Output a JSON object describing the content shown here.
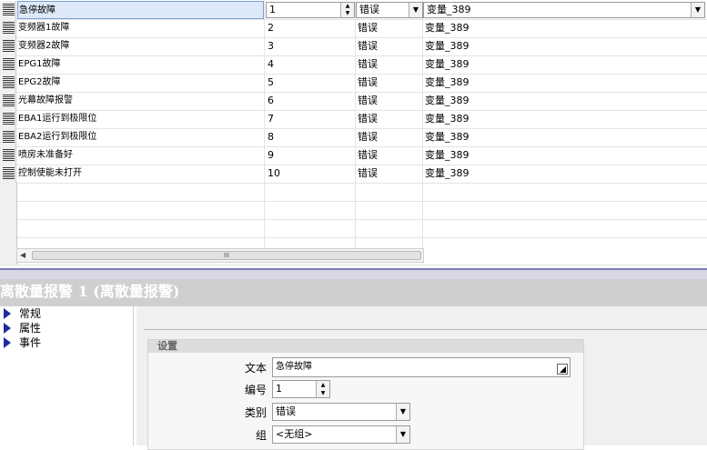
{
  "grid": {
    "rows": [
      {
        "name": "急停故障",
        "number": "1",
        "class": "错误",
        "tag": "变量_389"
      },
      {
        "name": "变频器1故障",
        "number": "2",
        "class": "错误",
        "tag": "变量_389"
      },
      {
        "name": "变频器2故障",
        "number": "3",
        "class": "错误",
        "tag": "变量_389"
      },
      {
        "name": "EPG1故障",
        "number": "4",
        "class": "错误",
        "tag": "变量_389"
      },
      {
        "name": "EPG2故障",
        "number": "5",
        "class": "错误",
        "tag": "变量_389"
      },
      {
        "name": "光幕故障报警",
        "number": "6",
        "class": "错误",
        "tag": "变量_389"
      },
      {
        "name": "EBA1运行到极限位",
        "number": "7",
        "class": "错误",
        "tag": "变量_389"
      },
      {
        "name": "EBA2运行到极限位",
        "number": "8",
        "class": "错误",
        "tag": "变量_389"
      },
      {
        "name": "喷房未准备好",
        "number": "9",
        "class": "错误",
        "tag": "变量_389"
      },
      {
        "name": "控制使能未打开",
        "number": "10",
        "class": "错误",
        "tag": "变量_389"
      }
    ],
    "scroll_thumb_glyph": "III"
  },
  "panel": {
    "title": "离散量报警 1 (离散量报警)",
    "nav": [
      "常规",
      "属性",
      "事件"
    ],
    "group_title": "设置",
    "fields": {
      "text_label": "文本",
      "text_value": "急停故障",
      "number_label": "编号",
      "number_value": "1",
      "class_label": "类别",
      "class_value": "错误",
      "group_label": "组",
      "group_value": "<无组>"
    }
  },
  "colors": {
    "selection": "#dde8f8",
    "splitter": "#7c7cb8",
    "nav_arrow": "#1c2c9c",
    "title_bar": "#cfcfcf"
  }
}
